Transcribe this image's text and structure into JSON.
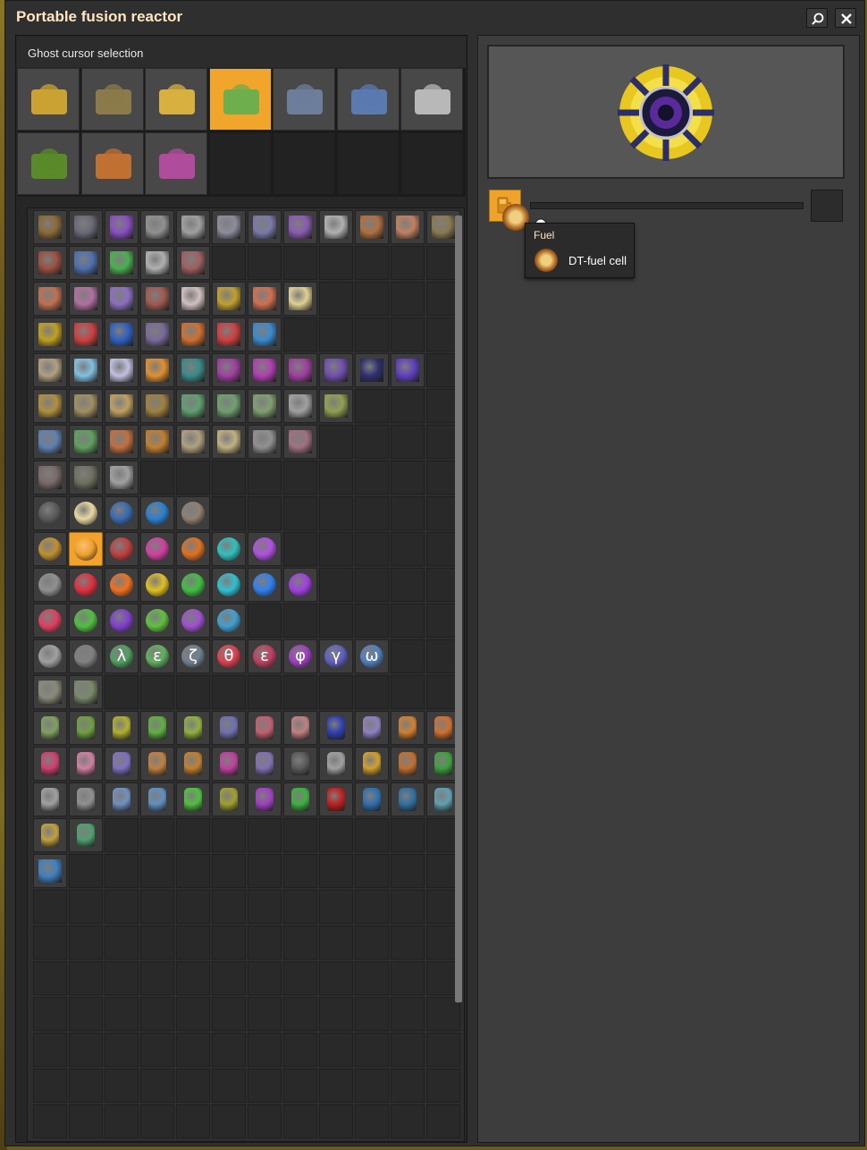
{
  "window": {
    "title": "Portable fusion reactor",
    "search_icon": "search-icon",
    "close_icon": "close-icon"
  },
  "ghost_panel": {
    "label": "Ghost cursor selection",
    "groups": [
      {
        "icon": "logistics-group-icon",
        "color": "#c9a233"
      },
      {
        "icon": "production-group-icon",
        "color": "#8b7a4a"
      },
      {
        "icon": "intermediates-group-icon",
        "color": "#d8b040"
      },
      {
        "icon": "circuits-group-icon",
        "color": "#6fae4c",
        "selected": true
      },
      {
        "icon": "spaceship-group-icon",
        "color": "#6c7e9c"
      },
      {
        "icon": "science-group-icon",
        "color": "#5a7ab0"
      },
      {
        "icon": "combat-group-icon",
        "color": "#b8b8b8"
      },
      {
        "icon": "tree-group-icon",
        "color": "#5a8a2a"
      },
      {
        "icon": "unsorted-group-icon",
        "color": "#c07030"
      },
      {
        "icon": "pickaxe-group-icon",
        "color": "#b04c9c"
      }
    ],
    "selected_group": 3
  },
  "item_rows": [
    [
      "#8a6a3a",
      "#6a6a78",
      "#8a4fc0",
      "#909090",
      "#a0a0a0",
      "#8c8c9c",
      "#7a7aa8",
      "#8a5cb0",
      "#b0b0b0",
      "#b07040",
      "#c08060",
      "#8a7a50"
    ],
    [
      "#9a5040",
      "#5070b0",
      "#4ab050",
      "#b0b0b0",
      "#a06060"
    ],
    [
      "#c07050",
      "#b070a0",
      "#8a70c0",
      "#a05a50",
      "#d0c0c0",
      "#c0a030",
      "#d07050",
      "#e0d090"
    ],
    [
      "#c0a020",
      "#d04040",
      "#3060c0",
      "#7a6a9a",
      "#d07030",
      "#d04040",
      "#3a8ad0"
    ],
    [
      "#b0a080",
      "#80c0e0",
      "#c0c0e0",
      "#e09030",
      "#3a8a8a",
      "#a040a0",
      "#b040b0",
      "#a040a0",
      "#7050b0",
      "#303070",
      "#6040c0"
    ],
    [
      "#b09040",
      "#a09060",
      "#c0a060",
      "#a08040",
      "#60a070",
      "#70a070",
      "#80a070",
      "#a0a0a0",
      "#90a050"
    ],
    [
      "#6080b0",
      "#60a060",
      "#c07040",
      "#c08030",
      "#b0a080",
      "#c0b080",
      "#909090",
      "#a07080"
    ],
    [
      "#7a6a6a",
      "#707060",
      "#a0a0a0"
    ],
    [
      "#5a5a5a",
      "#e8d8a0",
      "#3a6ab0",
      "#2a80d0",
      "#908070"
    ],
    [
      "#c09030",
      "#f0a030",
      "#c04040",
      "#d040a0",
      "#e07020",
      "#30c0c0",
      "#b050e0"
    ],
    [
      "#909090",
      "#e03040",
      "#f07020",
      "#e0c020",
      "#40c040",
      "#30c0d0",
      "#3080f0",
      "#a040e0"
    ],
    [
      "#e04060",
      "#50c040",
      "#8040d0",
      "#60c040",
      "#a050d0",
      "#40a0d0"
    ],
    [
      "#a0a0a0",
      "#808080",
      "#50a060",
      "#60b060",
      "#708090",
      "#e04050",
      "#c04060",
      "#a040c0",
      "#6060c0",
      "#5080c0"
    ],
    [
      "#8a8a7a",
      "#7a8a6a"
    ],
    [
      "#80a060",
      "#70a040",
      "#b0b030",
      "#60b040",
      "#90b040",
      "#7070b0",
      "#c06070",
      "#c08080",
      "#3040b0",
      "#9080c0",
      "#d08030",
      "#d07030"
    ],
    [
      "#d04070",
      "#d080a0",
      "#8070c0",
      "#c08040",
      "#c08030",
      "#c040a0",
      "#8070b0",
      "#5a5a5a",
      "#a0a0a0",
      "#d0a030",
      "#c07030",
      "#40a040"
    ],
    [
      "#a0a0a0",
      "#909090",
      "#7090c0",
      "#6090c0",
      "#50c040",
      "#a0a030",
      "#a040c0",
      "#40b040",
      "#c02020",
      "#3070b0",
      "#3070a0",
      "#60a0b0"
    ],
    [
      "#c0a040",
      "#50a070"
    ],
    [
      "#4080c0"
    ]
  ],
  "item_glyphs": {
    "12": [
      "",
      "",
      "λ",
      "ε",
      "ζ",
      "θ",
      "ε",
      "φ",
      "γ",
      "ω"
    ]
  },
  "item_selected": {
    "row": 9,
    "col": 1
  },
  "machine": {
    "preview_icon": "fusion-reactor-icon",
    "fuel_slot_icon": "fuel-icon",
    "fuel_progress": 0
  },
  "cursor": {
    "icon": "dt-fuel-cell-icon",
    "ghost_icon": "ghost-icon"
  },
  "tooltip": {
    "title": "Fuel",
    "item_label": "DT-fuel cell",
    "item_icon": "dt-fuel-cell-icon"
  }
}
